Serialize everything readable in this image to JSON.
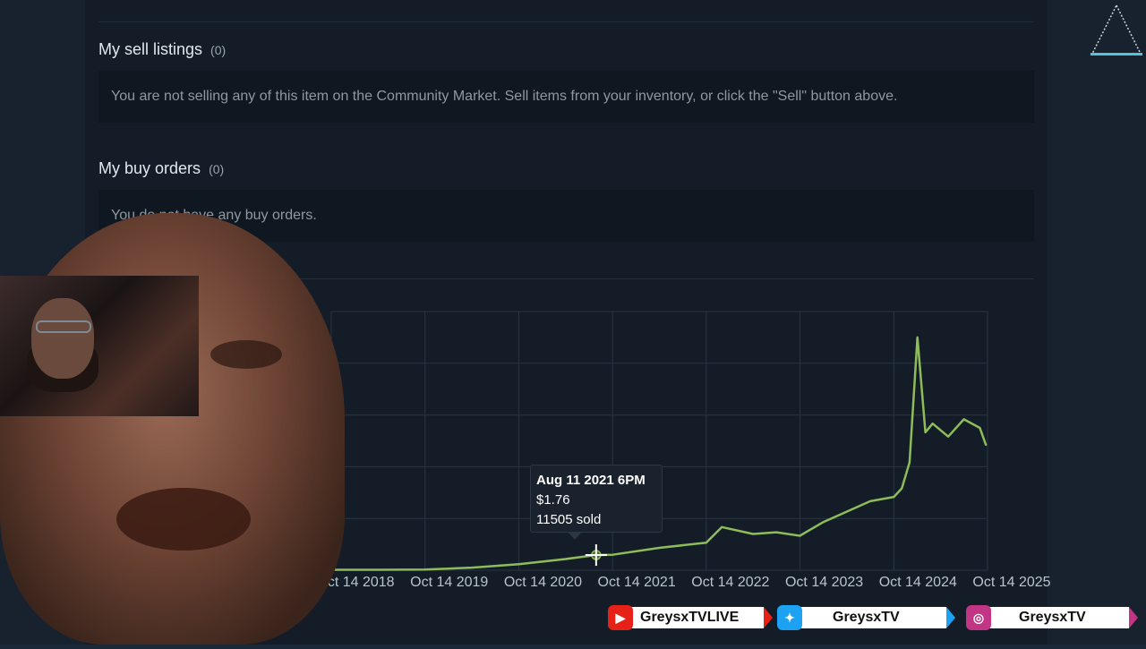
{
  "sell_listings": {
    "title": "My sell listings",
    "count": "(0)",
    "message": "You are not selling any of this item on the Community Market. Sell items from your inventory, or click the \"Sell\" button above."
  },
  "buy_orders": {
    "title": "My buy orders",
    "count": "(0)",
    "message": "You do not have any buy orders."
  },
  "tooltip": {
    "date": "Aug 11 2021 6PM",
    "price": "$1.76",
    "sold": "11505 sold"
  },
  "socials": [
    {
      "icon": "youtube-icon",
      "label": "GreysxTVLIVE",
      "color": "#e62117"
    },
    {
      "icon": "twitter-icon",
      "label": "GreysxTV",
      "color": "#1da1f2"
    },
    {
      "icon": "instagram-icon",
      "label": "GreysxTV",
      "color": "#c13584"
    }
  ],
  "colors": {
    "line": "#8fbc5a",
    "panel": "#131c27",
    "grid": "#2a3643"
  },
  "chart_data": {
    "type": "line",
    "x_tick_labels": [
      "Oct 14 2018",
      "Oct 14 2019",
      "Oct 14 2020",
      "Oct 14 2021",
      "Oct 14 2022",
      "Oct 14 2023",
      "Oct 14 2024",
      "Oct 14 2025"
    ],
    "series": [
      {
        "x": [
          "2018-10-14",
          "2019-04-14",
          "2019-10-14",
          "2020-04-14",
          "2020-10-14",
          "2021-04-14",
          "2021-08-11",
          "2021-10-14",
          "2022-04-14",
          "2022-10-14",
          "2022-12-14",
          "2023-04-14",
          "2023-07-14",
          "2023-10-14",
          "2024-01-14",
          "2024-04-14",
          "2024-07-14",
          "2024-10-14",
          "2024-11-14",
          "2024-12-14",
          "2025-01-14",
          "2025-02-14",
          "2025-03-14",
          "2025-05-14",
          "2025-07-14",
          "2025-09-14",
          "2025-10-08"
        ],
        "y": [
          0.05,
          0.05,
          0.08,
          0.3,
          0.7,
          1.3,
          1.76,
          1.8,
          2.6,
          3.2,
          5.0,
          4.2,
          4.4,
          4.0,
          5.6,
          6.8,
          8.0,
          8.5,
          9.5,
          12.5,
          27.0,
          16.0,
          17.0,
          15.5,
          17.5,
          16.5,
          14.5
        ]
      }
    ],
    "grid": true
  }
}
